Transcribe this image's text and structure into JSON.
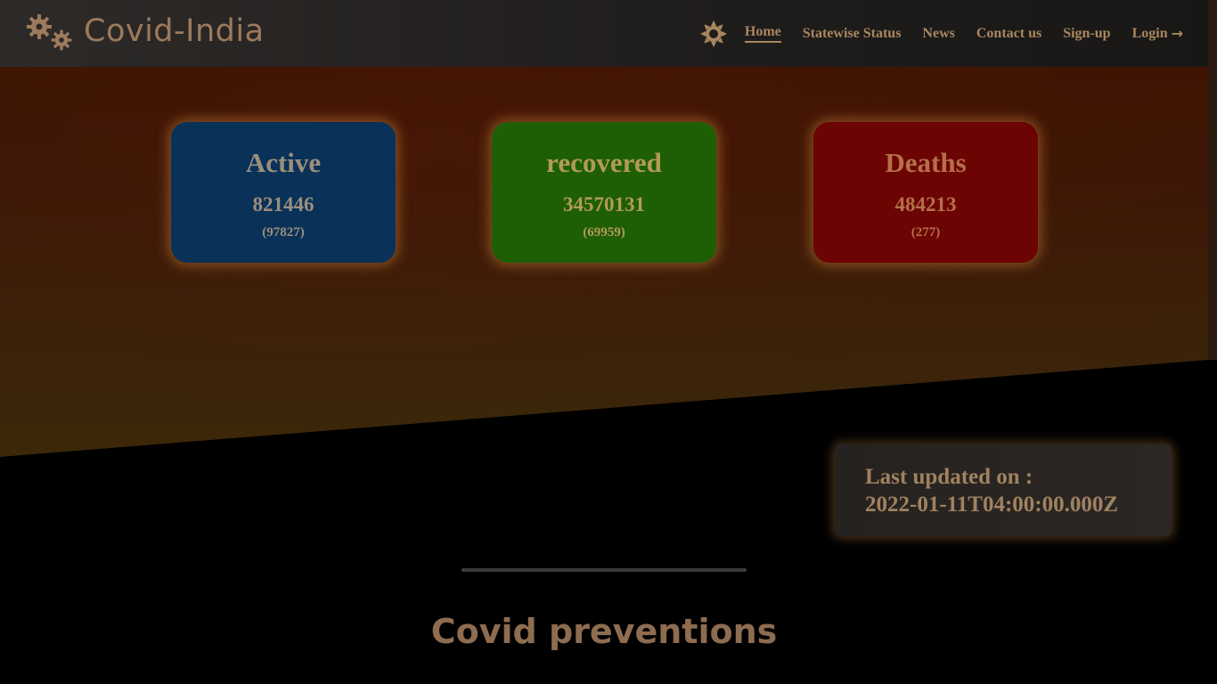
{
  "brand": {
    "name": "Covid-India",
    "icon": "gears-icon"
  },
  "nav": {
    "theme_icon": "sun-icon",
    "links": [
      {
        "label": "Home",
        "active": true
      },
      {
        "label": "Statewise Status"
      },
      {
        "label": "News"
      },
      {
        "label": "Contact us"
      },
      {
        "label": "Sign-up"
      },
      {
        "label": "Login",
        "icon": "arrow-right-icon"
      }
    ],
    "login_arrow": "→"
  },
  "stats": {
    "active": {
      "title": "Active",
      "value": "821446",
      "delta": "(97827)",
      "color": "#0a3158"
    },
    "recovered": {
      "title": "recovered",
      "value": "34570131",
      "delta": "(69959)",
      "color": "#1e5f06"
    },
    "deaths": {
      "title": "Deaths",
      "value": "484213",
      "delta": "(277)",
      "color": "#6c0404"
    }
  },
  "updated": {
    "label": "Last updated on :",
    "timestamp": "2022-01-11T04:00:00.000Z"
  },
  "preventions": {
    "title": "Covid preventions"
  },
  "colors": {
    "accent": "#a9875f",
    "header_bg": "#2d2a28",
    "page_bg": "#000000"
  }
}
